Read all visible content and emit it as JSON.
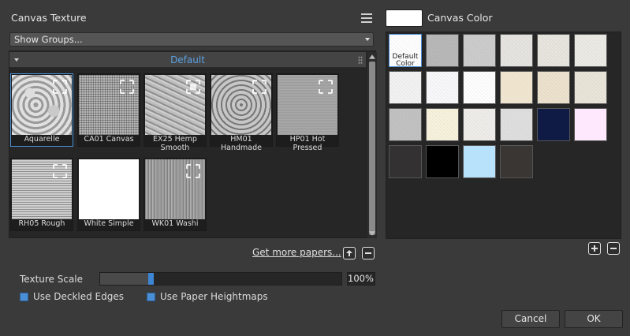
{
  "paper": {
    "title": "Canvas Texture",
    "group_select": "Show Groups...",
    "group_name": "Default",
    "tiles": [
      {
        "label": "Aquarelle",
        "selected": true
      },
      {
        "label": "CA01 Canvas"
      },
      {
        "label": "EX25 Hemp\nSmooth"
      },
      {
        "label": "HM01\nHandmade"
      },
      {
        "label": "HP01 Hot\nPressed"
      },
      {
        "label": "RH05 Rough"
      },
      {
        "label": "White Simple"
      },
      {
        "label": "WK01 Washi"
      }
    ],
    "get_more": "Get more papers...",
    "texture_scale_label": "Texture Scale",
    "texture_scale_value": "100%",
    "texture_scale_fraction": 0.21,
    "use_deckled_edges": "Use Deckled Edges",
    "use_paper_heightmaps": "Use Paper Heightmaps"
  },
  "canvas": {
    "title": "Canvas Color",
    "current_color": "#ffffff",
    "default_label": "Default\nColor",
    "swatches": [
      "#ffffff",
      "#b9b9b9",
      "#cdcdcd",
      "#e6e5e1",
      "#e8e6df",
      "#ecebe6",
      "#f3f3f3",
      "#f9f9fb",
      "#ffffff",
      "#f2e8d2",
      "#ede3cf",
      "#ebe6da",
      "#c3c3c3",
      "#f8f3dd",
      "#efeeea",
      "#e0e0e0",
      "#0f1a45",
      "#fde8fd",
      "#333131",
      "#000000",
      "#b8e2fb",
      "#393634"
    ]
  },
  "buttons": {
    "cancel": "Cancel",
    "ok": "OK"
  },
  "colors": {
    "accent": "#4a90d9",
    "group_text": "#5aa0e0",
    "background": "#3a3a3a"
  }
}
